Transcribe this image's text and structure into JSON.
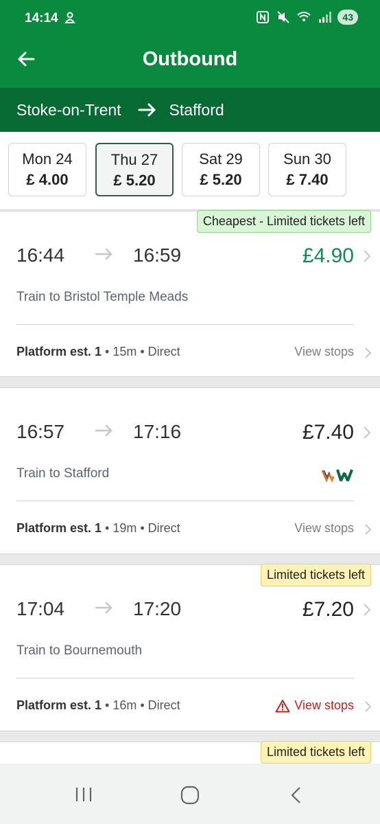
{
  "status": {
    "time": "14:14",
    "battery": "43"
  },
  "header": {
    "title": "Outbound"
  },
  "route": {
    "from": "Stoke-on-Trent",
    "to": "Stafford"
  },
  "dates": [
    {
      "day": "Mon 24",
      "price": "£ 4.00",
      "selected": false
    },
    {
      "day": "Thu 27",
      "price": "£ 5.20",
      "selected": true
    },
    {
      "day": "Sat 29",
      "price": "£ 5.20",
      "selected": false
    },
    {
      "day": "Sun 30",
      "price": "£ 7.40",
      "selected": false
    }
  ],
  "journeys": [
    {
      "badge": "Cheapest - Limited tickets left",
      "depart": "16:44",
      "arrive": "16:59",
      "price": "£4.90",
      "destination": "Train to Bristol Temple Meads",
      "platform": "Platform est. 1",
      "details": " • 15m • Direct",
      "view_stops": "View stops"
    },
    {
      "badge": "",
      "depart": "16:57",
      "arrive": "17:16",
      "price": "£7.40",
      "destination": "Train to Stafford",
      "platform": "Platform est. 1",
      "details": " • 19m • Direct",
      "view_stops": "View stops"
    },
    {
      "badge": "Limited tickets left",
      "depart": "17:04",
      "arrive": "17:20",
      "price": "£7.20",
      "destination": "Train to Bournemouth",
      "platform": "Platform est. 1",
      "details": " • 16m • Direct",
      "view_stops": "View stops"
    },
    {
      "badge": "Limited tickets left"
    }
  ],
  "colors": {
    "brand_green": "#0a8a3f",
    "route_green": "#086a33",
    "cheap_price": "#138a4e",
    "warning_red": "#c0211f"
  }
}
